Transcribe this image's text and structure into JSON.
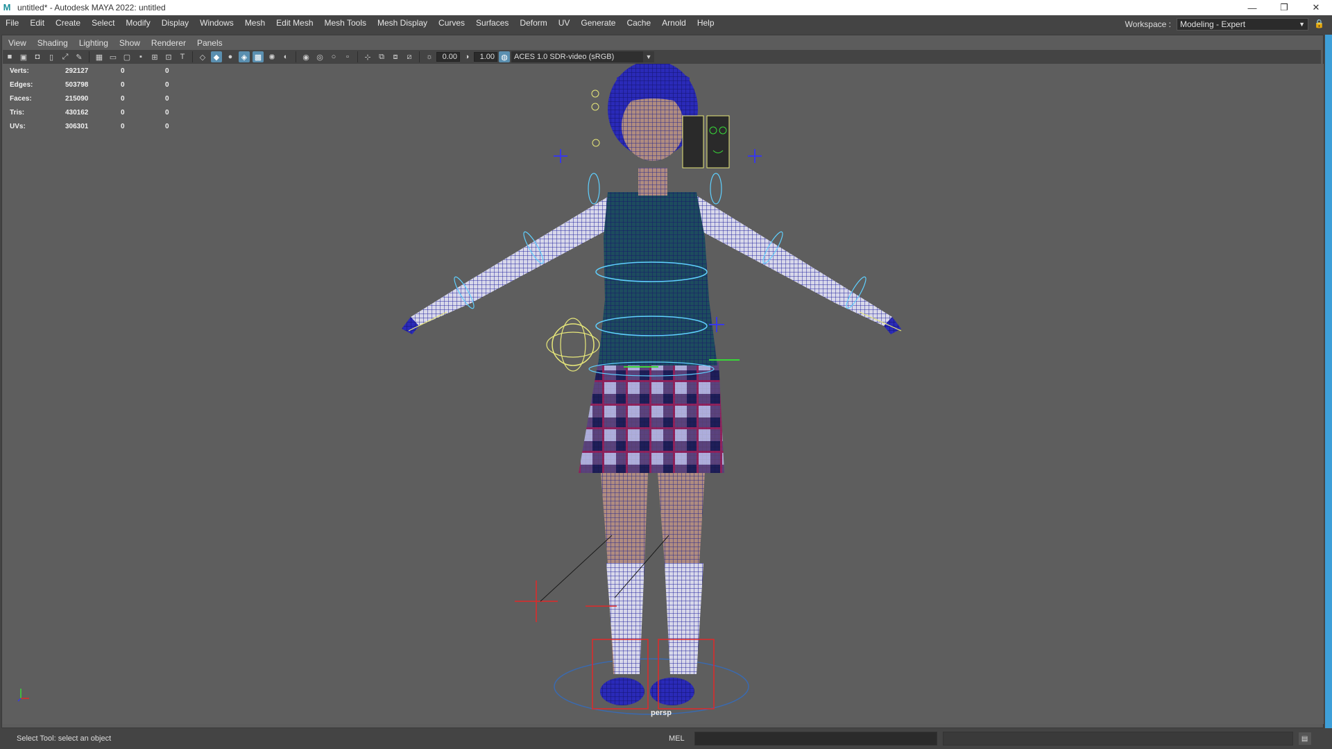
{
  "window": {
    "app_icon_glyph": "M",
    "title": "untitled* - Autodesk MAYA 2022: untitled",
    "minimize_glyph": "—",
    "restore_glyph": "❐",
    "close_glyph": "✕"
  },
  "menubar": {
    "items": [
      "File",
      "Edit",
      "Create",
      "Select",
      "Modify",
      "Display",
      "Windows",
      "Mesh",
      "Edit Mesh",
      "Mesh Tools",
      "Mesh Display",
      "Curves",
      "Surfaces",
      "Deform",
      "UV",
      "Generate",
      "Cache",
      "Arnold",
      "Help"
    ]
  },
  "workspace": {
    "label": "Workspace :",
    "value": "Modeling - Expert",
    "dropdown_glyph": "▼",
    "lock_glyph": "🔒"
  },
  "panel_menu": {
    "items": [
      "View",
      "Shading",
      "Lighting",
      "Show",
      "Renderer",
      "Panels"
    ]
  },
  "toolbar": {
    "exposure": "0.00",
    "gamma": "1.00",
    "color_space": "ACES 1.0 SDR-video (sRGB)",
    "dropdown_glyph": "▼"
  },
  "hud": {
    "rows": [
      {
        "label": "Verts:",
        "total": "292127",
        "sel": "0",
        "comp": "0"
      },
      {
        "label": "Edges:",
        "total": "503798",
        "sel": "0",
        "comp": "0"
      },
      {
        "label": "Faces:",
        "total": "215090",
        "sel": "0",
        "comp": "0"
      },
      {
        "label": "Tris:",
        "total": "430162",
        "sel": "0",
        "comp": "0"
      },
      {
        "label": "UVs:",
        "total": "306301",
        "sel": "0",
        "comp": "0"
      }
    ]
  },
  "viewport": {
    "camera": "persp"
  },
  "statusbar": {
    "status": "Select Tool: select an object",
    "mel_label": "MEL"
  },
  "colors": {
    "accent": "#3e9fd8",
    "wire_blue": "#1c1c8c",
    "ctrl_cyan": "#5fd0ff",
    "ctrl_yellow": "#e8e87a",
    "ctrl_red": "#e83030",
    "ctrl_green": "#38d838"
  }
}
